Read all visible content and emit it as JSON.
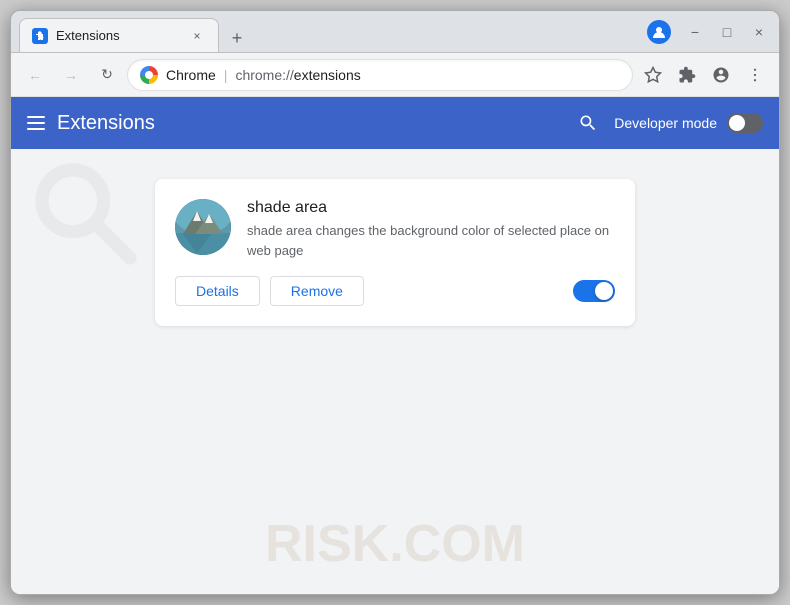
{
  "browser": {
    "tab": {
      "title": "Extensions",
      "icon_label": "puzzle-icon",
      "close_label": "×"
    },
    "new_tab_label": "+",
    "window_controls": {
      "minimize": "−",
      "maximize": "□",
      "close": "×"
    },
    "toolbar": {
      "back_label": "←",
      "forward_label": "→",
      "reload_label": "↻",
      "chrome_name": "Chrome",
      "separator": "|",
      "url_scheme": "chrome://",
      "url_path": "extensions",
      "star_label": "☆",
      "extensions_label": "🧩",
      "profile_label": "👤",
      "menu_label": "⋮"
    }
  },
  "extensions_page": {
    "header": {
      "menu_label": "≡",
      "title": "Extensions",
      "search_label": "🔍",
      "dev_mode_label": "Developer mode",
      "dev_mode_on": false
    },
    "card": {
      "name": "shade area",
      "description": "shade area changes the background color of selected place on web page",
      "details_btn": "Details",
      "remove_btn": "Remove",
      "enabled": true
    }
  },
  "watermark": {
    "text": "RISK.COM",
    "top_icon_label": "magnifier-watermark"
  }
}
